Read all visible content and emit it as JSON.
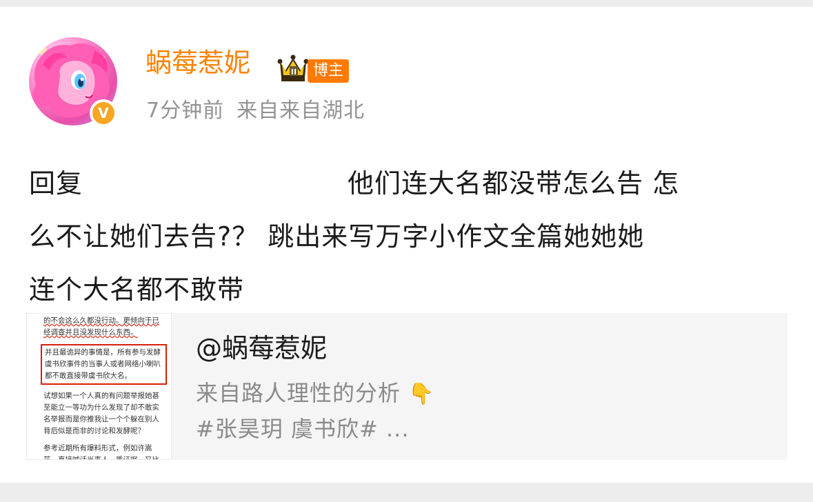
{
  "post": {
    "username": "蜗莓惹妮",
    "role_badge": "博主",
    "time": "7分钟前",
    "source": "来自来自湖北",
    "content": {
      "prefix": "回复",
      "line1_rest": "他们连大名都没带怎么告 怎",
      "line2": "么不让她们去告?？ 跳出来写万字小作文全篇她她她",
      "line3": "连个大名都不敢带"
    }
  },
  "quoted": {
    "user": "@蜗莓惹妮",
    "desc1": "来自路人理性的分析",
    "hand_icon": "👇",
    "desc2": "#张昊玥 虞书欣# ...",
    "thumbnail_text": {
      "p1": "的不会这么久都没行动。更倾向于已经调查并且没发现什么东西。",
      "p2": "并且最诡异的事情是，所有参与发酵虞书欣事件的当事人或者网络小喇叭都不敢直接带虞书欣大名。",
      "p3": "试想如果一个人真的有问题举报她甚至能立一等功为什么发现了却不敢实名举报而是你推我让一个个躲在别人背后似是而非的讨论和发酵呢？",
      "p4": "参考近期所有爆料形式，例如许嵩莎，直接喊话当事人，质证据。又比如脱粉站姐走路录音，也是直接喊话，晒证据，后续"
    }
  },
  "colors": {
    "username": "#ff8200",
    "badge": "#ff7a00",
    "meta": "#939393",
    "highlight_box": "#d81e06"
  }
}
